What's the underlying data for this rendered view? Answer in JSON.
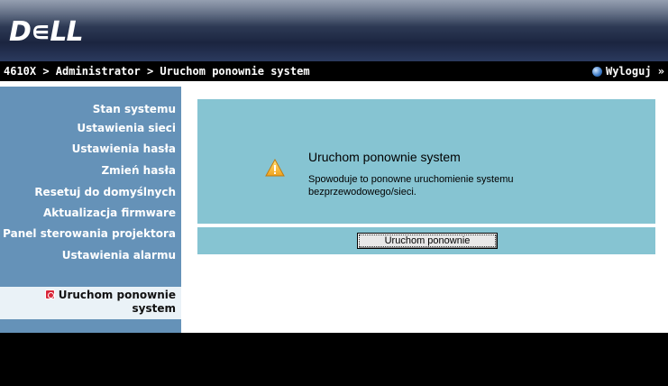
{
  "header": {
    "logo_text": "D∊LL"
  },
  "breadcrumb": {
    "path": "4610X > Administrator > Uruchom ponownie system",
    "logout_label": "Wyloguj »"
  },
  "sidebar": {
    "items": [
      {
        "label": "Stan systemu"
      },
      {
        "label": "Ustawienia sieci"
      },
      {
        "label": "Ustawienia hasła"
      },
      {
        "label": "Zmień hasła"
      },
      {
        "label": "Resetuj do domyślnych"
      },
      {
        "label": "Aktualizacja firmware"
      },
      {
        "label": "Panel sterowania projektora"
      },
      {
        "label": "Ustawienia alarmu"
      }
    ],
    "active": {
      "label_line1": "Uruchom ponownie",
      "label_line2": "system"
    }
  },
  "main": {
    "title": "Uruchom ponownie system",
    "description": "Spowoduje to ponowne uruchomienie systemu bezprzewodowego/sieci.",
    "restart_button_label": "Uruchom ponownie"
  },
  "icons": {
    "logout": "globe-icon",
    "warning": "warning-icon",
    "reboot": "reboot-icon"
  },
  "colors": {
    "sidebar": "#6592b8",
    "panel": "#86c4d2",
    "active_item": "#eaf2f7",
    "bar": "#000000"
  }
}
